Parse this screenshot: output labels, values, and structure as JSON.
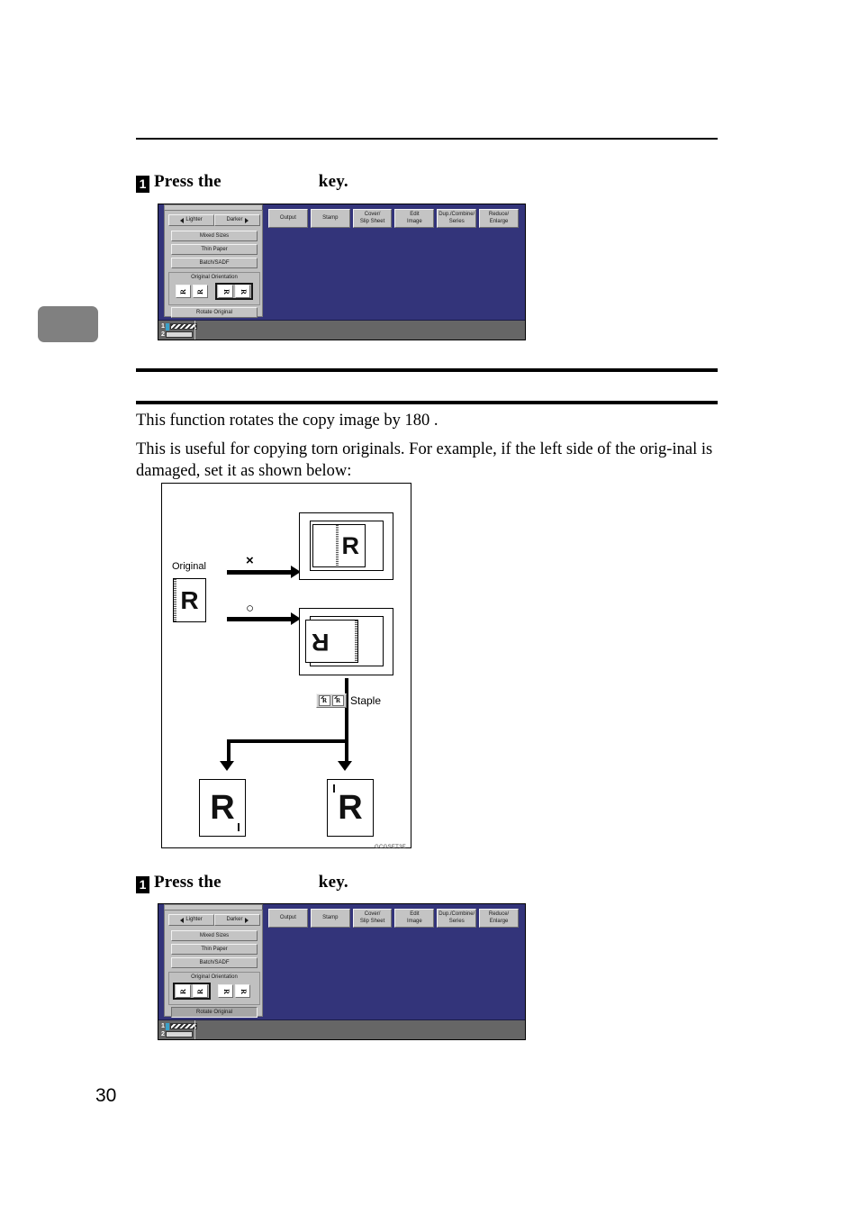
{
  "page": {
    "number": "30",
    "chapter_tab": ""
  },
  "steps": [
    {
      "num": "1",
      "text_before": "Press the",
      "text_after": "key."
    },
    {
      "num": "1",
      "text_before": "Press the",
      "text_after": "key."
    }
  ],
  "body": {
    "paragraph1": "This function rotates the copy image by 180 .",
    "paragraph2": "This is useful for copying torn originals. For example, if the left side of the orig-inal is damaged, set it as shown below:"
  },
  "lcd": {
    "background_color": "#33347a",
    "panel_color": "#c0c0c0",
    "status_color": "#666666",
    "lighter_label": "Lighter",
    "darker_label": "Darker",
    "function_buttons": [
      "Mixed Sizes",
      "Thin Paper",
      "Batch/SADF"
    ],
    "orientation_label": "Original Orientation",
    "orientation_icons": [
      "R",
      "R",
      "R",
      "R"
    ],
    "rotate_button": "Rotate Original",
    "tabs": [
      {
        "line1": "Output",
        "line2": ""
      },
      {
        "line1": "Stamp",
        "line2": ""
      },
      {
        "line1": "Cover/",
        "line2": "Slip Sheet"
      },
      {
        "line1": "Edit",
        "line2": "Image"
      },
      {
        "line1": "Dup./Combine/",
        "line2": "Series"
      },
      {
        "line1": "Reduce/",
        "line2": "Enlarge"
      }
    ],
    "tray_labels": [
      "1",
      "2"
    ],
    "panel1_selected_orientation": "right",
    "panel1_rotate_pressed": false,
    "panel2_selected_orientation": "left",
    "panel2_rotate_pressed": true
  },
  "figure": {
    "caption": "GCGSET3E",
    "original_label": "Original",
    "original_glyph": "R",
    "wrong_mark": "×",
    "right_mark": "○",
    "output_top_glyph": "R",
    "output_bottom_glyph": "R",
    "staple_label": "Staple",
    "staple_icon_glyph": "R",
    "result_left_glyph": "R",
    "result_right_glyph": "R"
  }
}
